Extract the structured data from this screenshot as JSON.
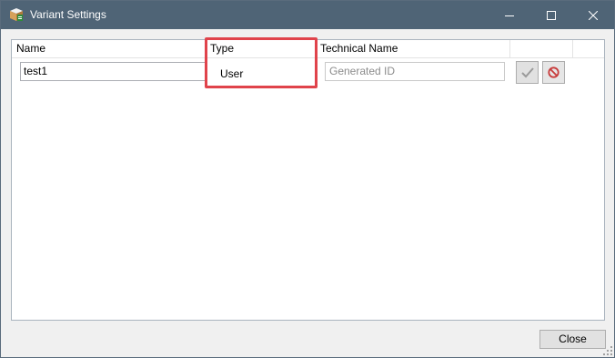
{
  "window": {
    "title": "Variant Settings",
    "icon": "variant-settings-app-icon"
  },
  "titlebar_controls": {
    "minimize": "minimize-icon",
    "maximize": "maximize-icon",
    "close": "close-icon"
  },
  "grid": {
    "columns": [
      "Name",
      "Type",
      "Technical Name",
      "",
      ""
    ],
    "rows": [
      {
        "name": "test1",
        "type": "User",
        "technical_name_placeholder": "Generated ID",
        "technical_name_value": ""
      }
    ],
    "row_actions": {
      "confirm_icon": "checkmark-icon",
      "cancel_icon": "cancel-icon"
    }
  },
  "footer": {
    "close_label": "Close"
  },
  "colors": {
    "titlebar": "#4f6476",
    "highlight": "#e0434b",
    "cancel_icon": "#c83b3b",
    "checkmark_icon": "#9a9a9a"
  }
}
